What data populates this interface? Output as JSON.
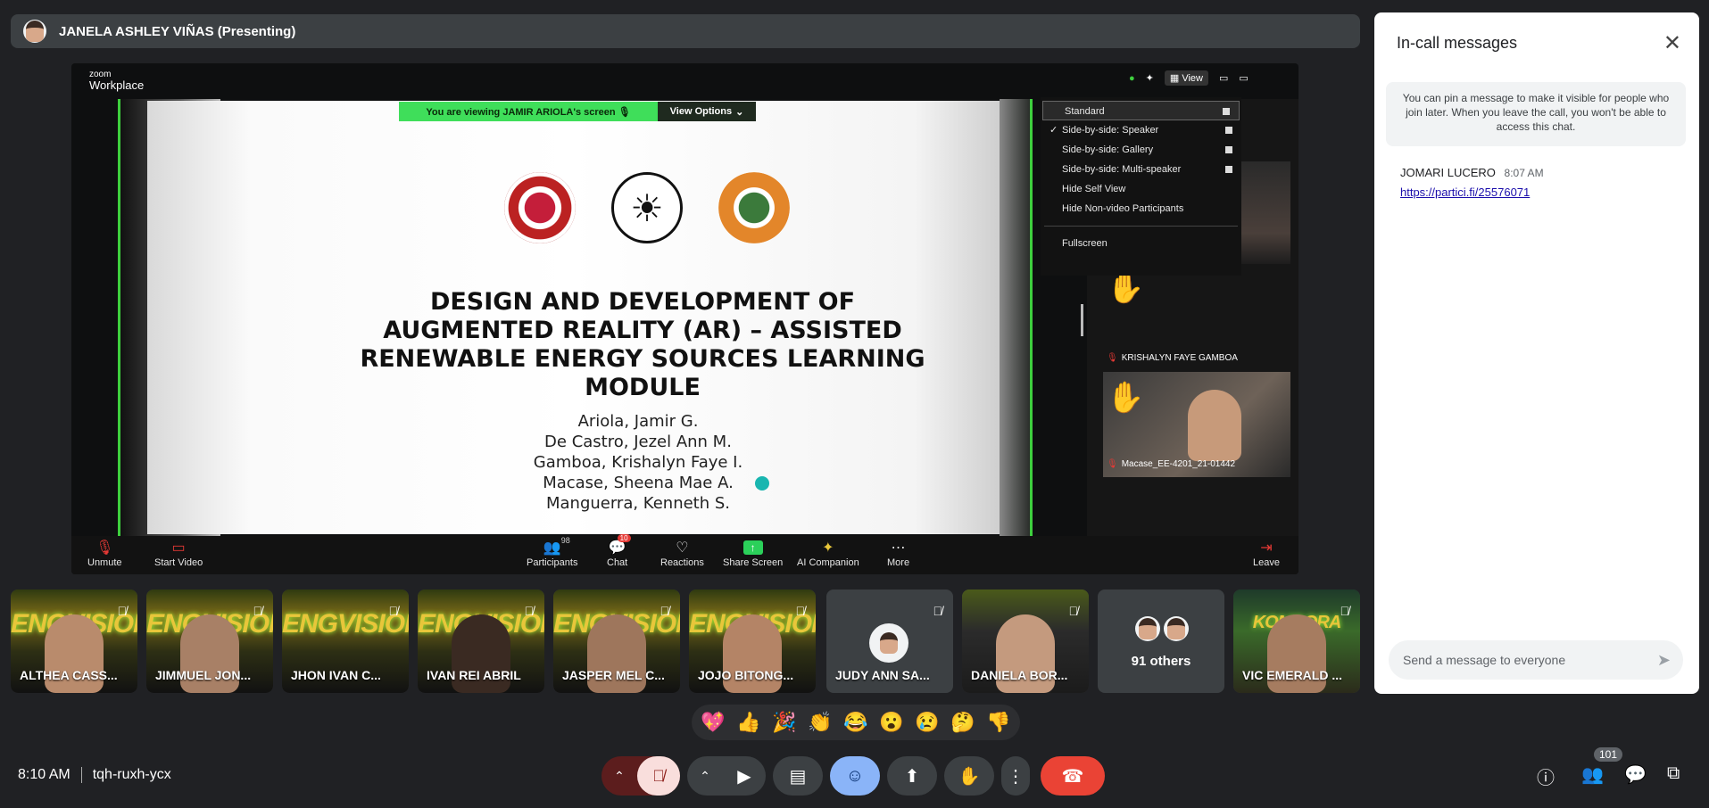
{
  "presenter": {
    "name": "JANELA ASHLEY VIÑAS (Presenting)"
  },
  "zoom": {
    "brand_top": "zoom",
    "brand_bottom": "Workplace",
    "viewing_banner": "You are viewing  JAMIR ARIOLA's screen  🎙",
    "view_options": "View Options",
    "view_button": "View",
    "menu": {
      "items": [
        "Standard",
        "Side-by-side: Speaker",
        "Side-by-side: Gallery",
        "Side-by-side: Multi-speaker",
        "Hide Self View",
        "Hide Non-video Participants"
      ],
      "checked": "✓",
      "fullscreen": "Fullscreen"
    },
    "participant_labels": [
      "KRISHALYN FAYE GAMBOA",
      "Macase_EE-4201_21-01442"
    ],
    "toolbar": {
      "unmute": "Unmute",
      "start_video": "Start Video",
      "participants": "Participants",
      "participants_count": "98",
      "chat": "Chat",
      "chat_badge": "10",
      "reactions": "Reactions",
      "share_screen": "Share Screen",
      "ai_companion": "AI Companion",
      "more": "More",
      "leave": "Leave"
    }
  },
  "slide": {
    "title": "DESIGN AND DEVELOPMENT OF AUGMENTED REALITY (AR) – ASSISTED RENEWABLE ENERGY SOURCES LEARNING MODULE",
    "authors": [
      "Ariola, Jamir G.",
      "De Castro, Jezel Ann M.",
      "Gamboa, Krishalyn Faye I.",
      "Macase, Sheena Mae A.",
      "Manguerra, Kenneth S."
    ]
  },
  "tiles": [
    {
      "name": "ALTHEA CASS...",
      "banner": "ENGVISION"
    },
    {
      "name": "JIMMUEL JON...",
      "banner": "ENGVISION"
    },
    {
      "name": "JHON IVAN C...",
      "banner": "ENGVISION"
    },
    {
      "name": "IVAN REI ABRIL",
      "banner": "ENGVISION"
    },
    {
      "name": "JASPER MEL C...",
      "banner": "ENGVISION"
    },
    {
      "name": "JOJO BITONG...",
      "banner": "ENGVISION"
    },
    {
      "name": "JUDY ANN SA..."
    },
    {
      "name": "DANIELA BOR..."
    },
    {
      "name": "91 others"
    },
    {
      "name": "VIC EMERALD ...",
      "banner": "KOMBORA"
    }
  ],
  "reactions": [
    "💖",
    "👍",
    "🎉",
    "👏",
    "😂",
    "😮",
    "😢",
    "🤔",
    "👎"
  ],
  "meeting": {
    "time": "8:10 AM",
    "code": "tqh-ruxh-ycx"
  },
  "people_count": "101",
  "chat": {
    "title": "In-call messages",
    "notice": "You can pin a message to make it visible for people who join later. When you leave the call, you won't be able to access this chat.",
    "messages": [
      {
        "sender": "JOMARI LUCERO",
        "time": "8:07 AM",
        "text": "https://partici.fi/25576071"
      }
    ],
    "input_placeholder": "Send a message to everyone"
  },
  "colors": {
    "accent_blue": "#8ab4f8",
    "leave_red": "#ea4335",
    "zoom_green": "#3ecf3e",
    "mic_off_bg": "#f9dedc"
  }
}
